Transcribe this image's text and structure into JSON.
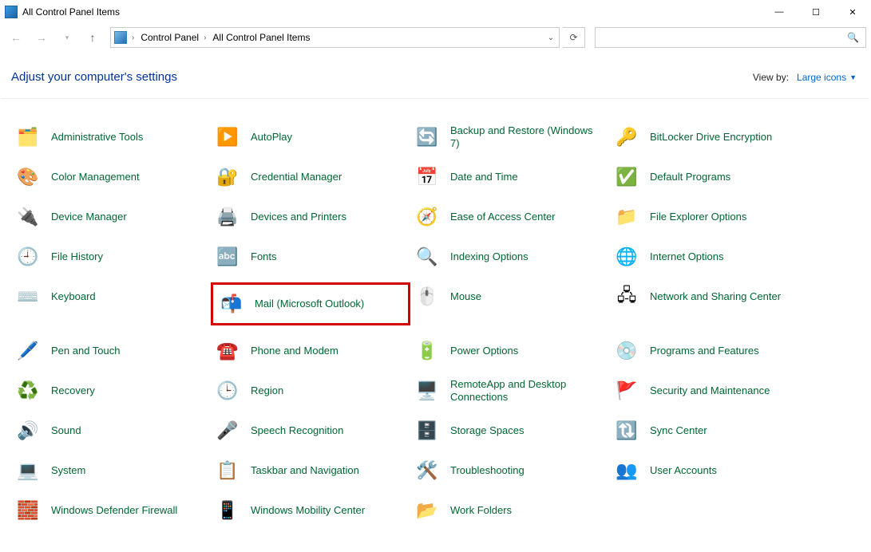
{
  "window": {
    "title": "All Control Panel Items"
  },
  "breadcrumb": {
    "root": "Control Panel",
    "current": "All Control Panel Items"
  },
  "header": {
    "title": "Adjust your computer's settings",
    "viewby_label": "View by:",
    "viewby_value": "Large icons"
  },
  "items": [
    {
      "label": "Administrative Tools",
      "icon": "admin-tools-icon"
    },
    {
      "label": "AutoPlay",
      "icon": "autoplay-icon"
    },
    {
      "label": "Backup and Restore (Windows 7)",
      "icon": "backup-restore-icon"
    },
    {
      "label": "BitLocker Drive Encryption",
      "icon": "bitlocker-icon"
    },
    {
      "label": "Color Management",
      "icon": "color-management-icon"
    },
    {
      "label": "Credential Manager",
      "icon": "credential-manager-icon"
    },
    {
      "label": "Date and Time",
      "icon": "date-time-icon"
    },
    {
      "label": "Default Programs",
      "icon": "default-programs-icon"
    },
    {
      "label": "Device Manager",
      "icon": "device-manager-icon"
    },
    {
      "label": "Devices and Printers",
      "icon": "devices-printers-icon"
    },
    {
      "label": "Ease of Access Center",
      "icon": "ease-of-access-icon"
    },
    {
      "label": "File Explorer Options",
      "icon": "file-explorer-options-icon"
    },
    {
      "label": "File History",
      "icon": "file-history-icon"
    },
    {
      "label": "Fonts",
      "icon": "fonts-icon"
    },
    {
      "label": "Indexing Options",
      "icon": "indexing-options-icon"
    },
    {
      "label": "Internet Options",
      "icon": "internet-options-icon"
    },
    {
      "label": "Keyboard",
      "icon": "keyboard-icon"
    },
    {
      "label": "Mail (Microsoft Outlook)",
      "icon": "mail-icon",
      "highlight": true
    },
    {
      "label": "Mouse",
      "icon": "mouse-icon"
    },
    {
      "label": "Network and Sharing Center",
      "icon": "network-sharing-icon"
    },
    {
      "label": "Pen and Touch",
      "icon": "pen-touch-icon"
    },
    {
      "label": "Phone and Modem",
      "icon": "phone-modem-icon"
    },
    {
      "label": "Power Options",
      "icon": "power-options-icon"
    },
    {
      "label": "Programs and Features",
      "icon": "programs-features-icon"
    },
    {
      "label": "Recovery",
      "icon": "recovery-icon"
    },
    {
      "label": "Region",
      "icon": "region-icon"
    },
    {
      "label": "RemoteApp and Desktop Connections",
      "icon": "remoteapp-icon"
    },
    {
      "label": "Security and Maintenance",
      "icon": "security-maintenance-icon"
    },
    {
      "label": "Sound",
      "icon": "sound-icon"
    },
    {
      "label": "Speech Recognition",
      "icon": "speech-recognition-icon"
    },
    {
      "label": "Storage Spaces",
      "icon": "storage-spaces-icon"
    },
    {
      "label": "Sync Center",
      "icon": "sync-center-icon"
    },
    {
      "label": "System",
      "icon": "system-icon"
    },
    {
      "label": "Taskbar and Navigation",
      "icon": "taskbar-navigation-icon"
    },
    {
      "label": "Troubleshooting",
      "icon": "troubleshooting-icon"
    },
    {
      "label": "User Accounts",
      "icon": "user-accounts-icon"
    },
    {
      "label": "Windows Defender Firewall",
      "icon": "defender-firewall-icon"
    },
    {
      "label": "Windows Mobility Center",
      "icon": "mobility-center-icon"
    },
    {
      "label": "Work Folders",
      "icon": "work-folders-icon"
    }
  ],
  "icon_glyphs": {
    "admin-tools-icon": "🗂️",
    "autoplay-icon": "▶️",
    "backup-restore-icon": "🔄",
    "bitlocker-icon": "🔑",
    "color-management-icon": "🎨",
    "credential-manager-icon": "🔐",
    "date-time-icon": "📅",
    "default-programs-icon": "✅",
    "device-manager-icon": "🔌",
    "devices-printers-icon": "🖨️",
    "ease-of-access-icon": "🧭",
    "file-explorer-options-icon": "📁",
    "file-history-icon": "🕘",
    "fonts-icon": "🔤",
    "indexing-options-icon": "🔍",
    "internet-options-icon": "🌐",
    "keyboard-icon": "⌨️",
    "mail-icon": "📬",
    "mouse-icon": "🖱️",
    "network-sharing-icon": "🖧",
    "pen-touch-icon": "🖊️",
    "phone-modem-icon": "☎️",
    "power-options-icon": "🔋",
    "programs-features-icon": "💿",
    "recovery-icon": "♻️",
    "region-icon": "🕒",
    "remoteapp-icon": "🖥️",
    "security-maintenance-icon": "🚩",
    "sound-icon": "🔊",
    "speech-recognition-icon": "🎤",
    "storage-spaces-icon": "🗄️",
    "sync-center-icon": "🔃",
    "system-icon": "💻",
    "taskbar-navigation-icon": "📋",
    "troubleshooting-icon": "🛠️",
    "user-accounts-icon": "👥",
    "defender-firewall-icon": "🧱",
    "mobility-center-icon": "📱",
    "work-folders-icon": "📂"
  }
}
